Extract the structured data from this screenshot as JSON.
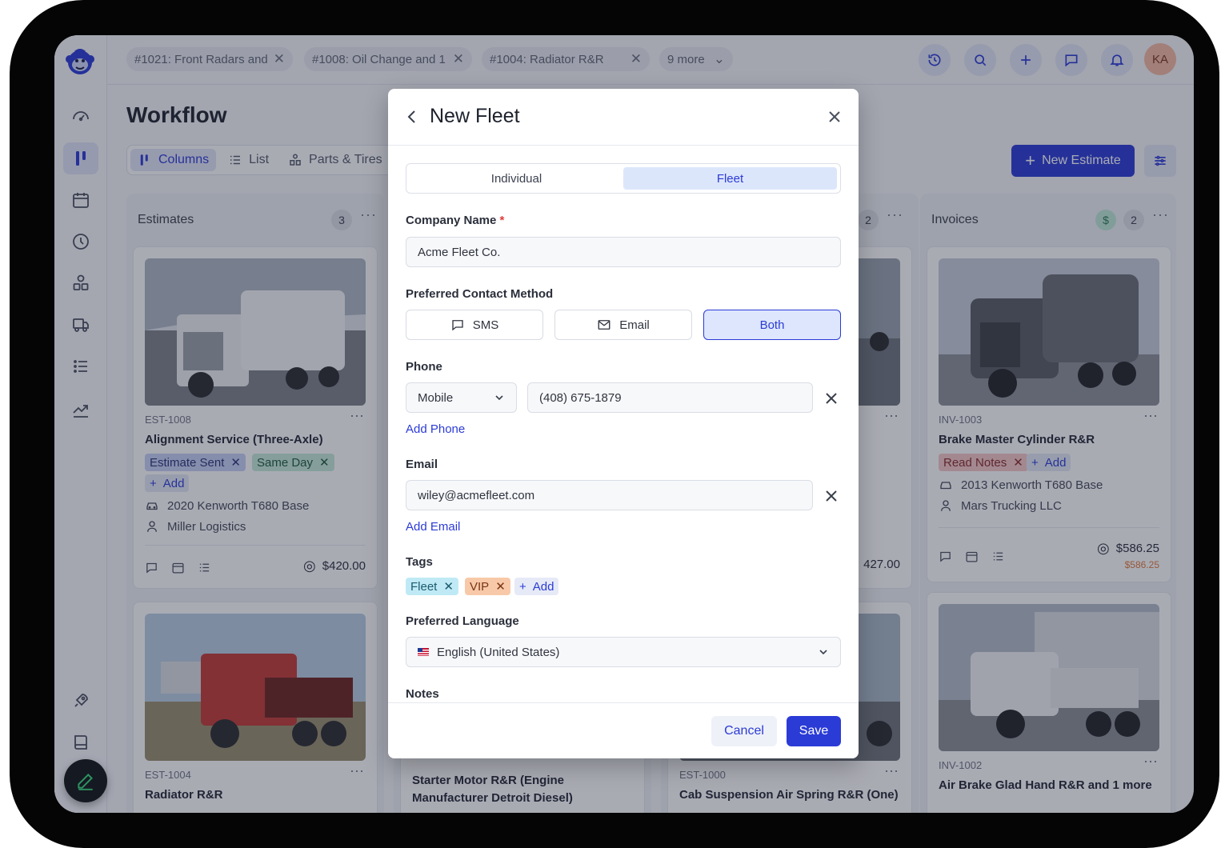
{
  "topbar": {
    "tabs": [
      {
        "label": "#1021: Front Radars and"
      },
      {
        "label": "#1008: Oil Change and 1"
      },
      {
        "label": "#1004: Radiator R&R"
      }
    ],
    "more_label": "9 more",
    "avatar_initials": "KA"
  },
  "page": {
    "title": "Workflow",
    "view_tabs": [
      "Columns",
      "List",
      "Parts & Tires"
    ],
    "new_estimate_label": "New Estimate"
  },
  "columns": {
    "estimates": {
      "title": "Estimates",
      "count": "3",
      "card1": {
        "id": "EST-1008",
        "title": "Alignment Service (Three-Axle)",
        "tags": [
          "Estimate Sent",
          "Same Day"
        ],
        "add_label": "Add",
        "vehicle": "2020 Kenworth T680 Base",
        "customer": "Miller Logistics",
        "price": "$420.00"
      },
      "card2": {
        "id": "EST-1004",
        "title": "Radiator R&R"
      }
    },
    "middle": {
      "card2_title": "Starter Motor R&R (Engine Manufacturer Detroit Diesel)"
    },
    "third": {
      "count": "2",
      "price_partial": "427.00",
      "card2_id": "EST-1000",
      "card2_title": "Cab Suspension Air Spring R&R (One)"
    },
    "invoices": {
      "title": "Invoices",
      "count": "2",
      "badge": "$",
      "card1": {
        "id": "INV-1003",
        "title": "Brake Master Cylinder R&R",
        "tags": [
          "Read Notes"
        ],
        "add_label": "Add",
        "vehicle": "2013 Kenworth T680 Base",
        "customer": "Mars Trucking LLC",
        "price": "$586.25",
        "due": "$586.25"
      },
      "card2": {
        "id": "INV-1002",
        "title": "Air Brake Glad Hand R&R and 1 more"
      }
    }
  },
  "modal": {
    "title": "New Fleet",
    "segments": [
      "Individual",
      "Fleet"
    ],
    "active_segment": "Fleet",
    "company_label": "Company Name",
    "company_required": "*",
    "company_value": "Acme Fleet Co.",
    "contact_label": "Preferred Contact Method",
    "contact_options": [
      "SMS",
      "Email",
      "Both"
    ],
    "contact_selected": "Both",
    "phone_label": "Phone",
    "phone_type": "Mobile",
    "phone_value": "(408) 675-1879",
    "add_phone": "Add Phone",
    "email_label": "Email",
    "email_value": "wiley@acmefleet.com",
    "add_email": "Add Email",
    "tags_label": "Tags",
    "tags": [
      "Fleet",
      "VIP"
    ],
    "add_tag": "Add",
    "language_label": "Preferred Language",
    "language_value": "English (United States)",
    "notes_label": "Notes",
    "cancel_label": "Cancel",
    "save_label": "Save"
  },
  "colors": {
    "accent": "#2b3bd6",
    "tag_estimate_sent": "#c7d1f6",
    "tag_same_day": "#c6ebd9",
    "tag_read_notes": "#f6c7c7",
    "tag_fleet": "#bfeaf5",
    "tag_vip": "#f8c9a8"
  }
}
